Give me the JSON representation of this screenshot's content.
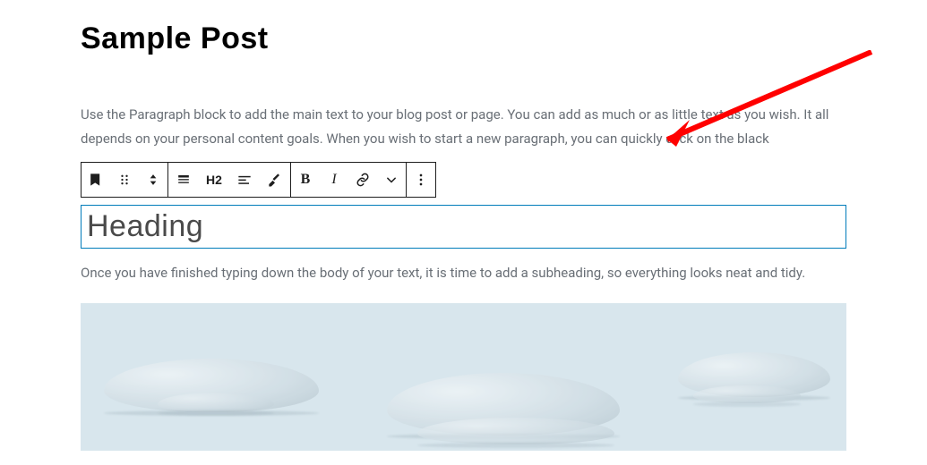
{
  "post": {
    "title": "Sample Post",
    "paragraph1": "Use the Paragraph block to add the main text to your blog post or page. You can add as much or as little text as you wish. It all depends on your personal content goals. When you wish to start a new paragraph, you can quickly click on the black",
    "heading_block_text": "Heading",
    "paragraph2": "Once you have finished typing down the body of your text, it is time to add a subheading, so everything looks neat and tidy."
  },
  "toolbar": {
    "heading_level": "H2",
    "bold_glyph": "B",
    "italic_glyph": "I"
  },
  "annotation": {
    "arrow_color": "#ff0000"
  }
}
